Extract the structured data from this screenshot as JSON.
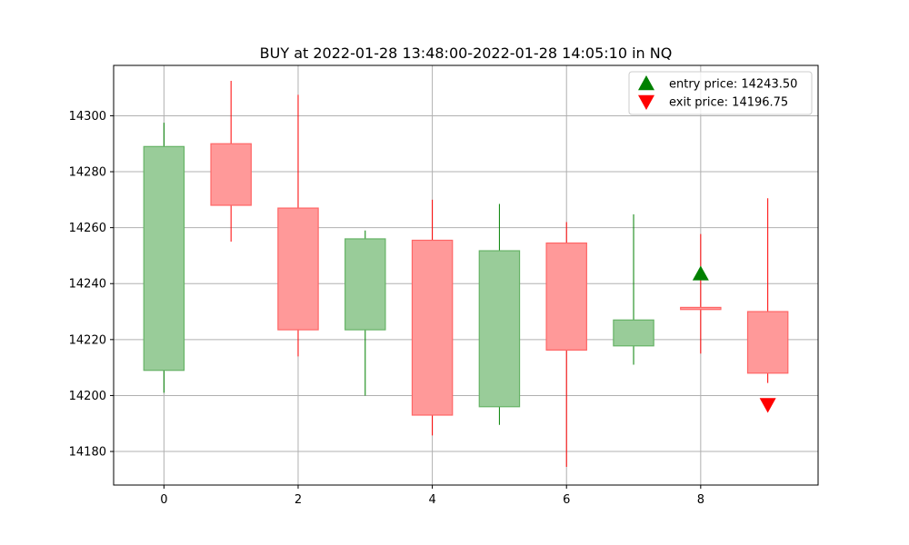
{
  "chart_data": {
    "type": "candlestick",
    "title": "BUY at 2022-01-28 13:48:00-2022-01-28 14:05:10 in NQ",
    "xlabel": "",
    "ylabel": "",
    "xlim": [
      -0.75,
      9.75
    ],
    "ylim": [
      14168,
      14318
    ],
    "x_ticks": [
      0,
      2,
      4,
      6,
      8
    ],
    "y_ticks": [
      14180,
      14200,
      14220,
      14240,
      14260,
      14280,
      14300
    ],
    "grid": true,
    "legend_position": "top-right",
    "colors": {
      "up_body": "#99cc99",
      "up_edge": "#66b366",
      "up_wick": "#008000",
      "down_body": "#ff9999",
      "down_edge": "#ff6666",
      "down_wick": "#ff0000",
      "entry_marker": "#008000",
      "exit_marker": "#ff0000",
      "grid": "#b0b0b0"
    },
    "candles": [
      {
        "x": 0,
        "open": 14209,
        "high": 14297.5,
        "low": 14201,
        "close": 14289
      },
      {
        "x": 1,
        "open": 14290,
        "high": 14312.5,
        "low": 14255,
        "close": 14268
      },
      {
        "x": 2,
        "open": 14267,
        "high": 14307.5,
        "low": 14214,
        "close": 14223.5
      },
      {
        "x": 3,
        "open": 14223.5,
        "high": 14259,
        "low": 14200,
        "close": 14256
      },
      {
        "x": 4,
        "open": 14255.5,
        "high": 14270,
        "low": 14185.75,
        "close": 14193
      },
      {
        "x": 5,
        "open": 14196,
        "high": 14268.5,
        "low": 14189.5,
        "close": 14251.75
      },
      {
        "x": 6,
        "open": 14254.5,
        "high": 14262,
        "low": 14174.5,
        "close": 14216.25
      },
      {
        "x": 7,
        "open": 14217.75,
        "high": 14264.75,
        "low": 14211,
        "close": 14227
      },
      {
        "x": 8,
        "open": 14231.5,
        "high": 14257.75,
        "low": 14215,
        "close": 14230.75
      },
      {
        "x": 9,
        "open": 14230,
        "high": 14270.5,
        "low": 14204.5,
        "close": 14208
      }
    ],
    "markers": [
      {
        "name": "entry price: 14243.50",
        "x": 8,
        "y": 14243.5,
        "shape": "triangle-up"
      },
      {
        "name": "exit price: 14196.75",
        "x": 9,
        "y": 14196.75,
        "shape": "triangle-down"
      }
    ]
  }
}
